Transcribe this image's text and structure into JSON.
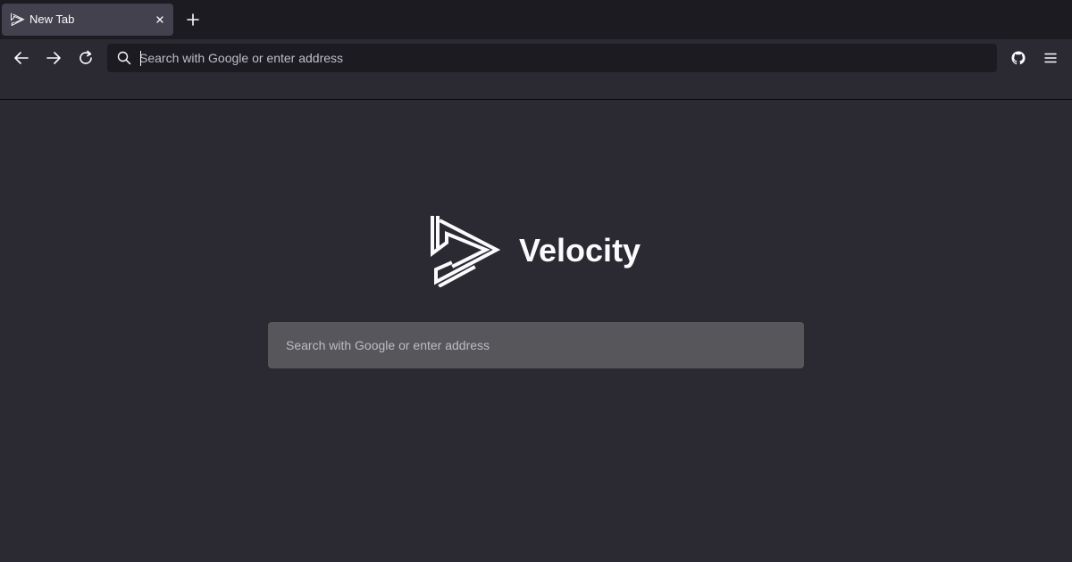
{
  "browser": {
    "tab": {
      "title": "New Tab",
      "icon": "velocity-logo-icon",
      "close_icon": "close-icon"
    },
    "new_tab_icon": "plus-icon",
    "nav": {
      "back_icon": "arrow-left-icon",
      "forward_icon": "arrow-right-icon",
      "reload_icon": "reload-icon",
      "github_icon": "github-icon",
      "menu_icon": "hamburger-menu-icon"
    },
    "urlbar": {
      "icon": "search-icon",
      "placeholder": "Search with Google or enter address",
      "value": ""
    }
  },
  "main": {
    "logo_icon": "velocity-logo-icon",
    "brand_name": "Velocity",
    "search": {
      "placeholder": "Search with Google or enter address",
      "value": ""
    }
  },
  "colors": {
    "background": "#2b2a33",
    "tabstrip": "#1c1b22",
    "active_tab": "#42414d",
    "urlbar": "#1c1b22",
    "main_search": "#56565b",
    "text": "#fbfbfe"
  }
}
